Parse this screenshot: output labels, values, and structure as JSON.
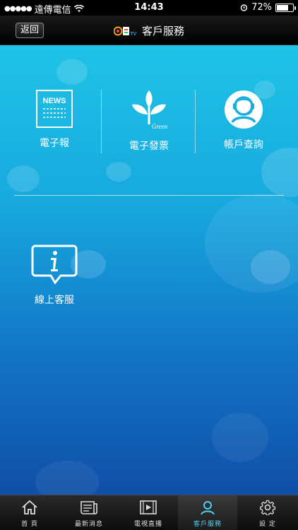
{
  "status_bar": {
    "carrier": "遠傳電信",
    "time": "14:43",
    "battery": "72%",
    "battery_level": 0.72
  },
  "nav": {
    "back_label": "返回",
    "title": "客戶服務",
    "logo_text": "民視TV"
  },
  "menu": {
    "items": [
      {
        "label": "電子報",
        "icon": "news-icon",
        "icon_text": "NEWS"
      },
      {
        "label": "電子發票",
        "icon": "green-leaf-icon",
        "icon_text": "Green"
      },
      {
        "label": "帳戶查詢",
        "icon": "headset-agent-icon"
      },
      {
        "label": "線上客服",
        "icon": "info-chat-icon"
      }
    ]
  },
  "tabbar": {
    "items": [
      {
        "label": "首 頁",
        "icon": "home-icon"
      },
      {
        "label": "最新消息",
        "icon": "news-list-icon"
      },
      {
        "label": "電視直播",
        "icon": "video-icon"
      },
      {
        "label": "客戶服務",
        "icon": "customer-service-icon",
        "active": true
      },
      {
        "label": "設 定",
        "icon": "gear-icon"
      }
    ]
  }
}
